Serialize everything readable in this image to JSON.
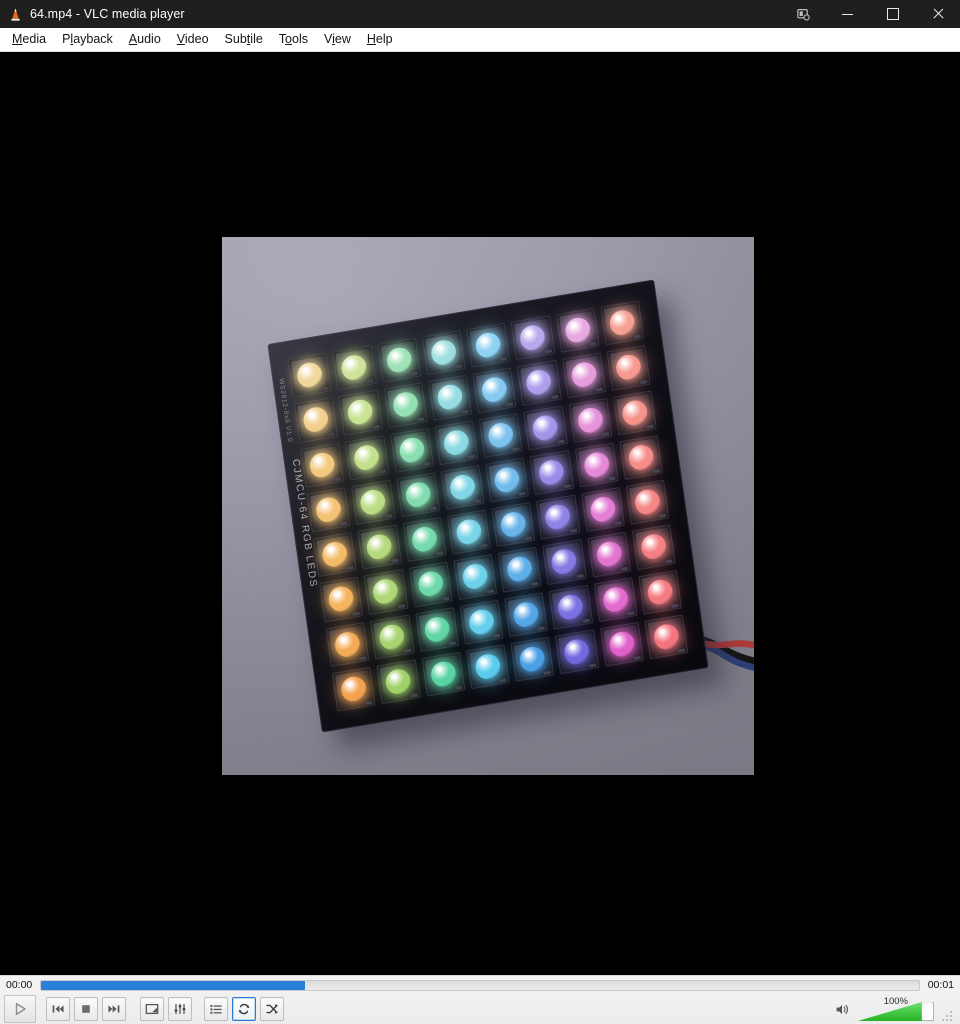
{
  "window": {
    "title": "64.mp4 - VLC media player",
    "app_icon": "vlc-cone-icon",
    "buttons": {
      "snap_label": "snap-layout-icon",
      "minimize_label": "minimize-icon",
      "maximize_label": "restore-icon",
      "close_label": "close-icon"
    }
  },
  "menubar": {
    "items": [
      {
        "label": "Media",
        "accel": "M",
        "before": "",
        "after": "edia"
      },
      {
        "label": "Playback",
        "accel": "l",
        "before": "P",
        "after": "ayback"
      },
      {
        "label": "Audio",
        "accel": "A",
        "before": "",
        "after": "udio"
      },
      {
        "label": "Video",
        "accel": "V",
        "before": "",
        "after": "ideo"
      },
      {
        "label": "Subtitle",
        "accel": "t",
        "before": "Sub",
        "after": "le"
      },
      {
        "label": "Tools",
        "accel": "o",
        "before": "T",
        "after": "ols"
      },
      {
        "label": "View",
        "accel": "i",
        "before": "V",
        "after": "ew"
      },
      {
        "label": "Help",
        "accel": "H",
        "before": "",
        "after": "elp"
      }
    ]
  },
  "video": {
    "description": "CJMCU-64 8x8 RGB LED matrix board lit in a rainbow gradient, lying on a light gray-lavender surface with a twisted red/blue/black wire harness exiting the lower-right corner",
    "board_silkscreen": "CJMCU-64 RGB LEDS",
    "board_silkscreen_small": "WS2812-8x8 V1.0",
    "background_color": "#9a9aab",
    "letterbox_color": "#000000",
    "led_rows": [
      [
        "#f0d79a",
        "#cfe39a",
        "#9fe2b6",
        "#9fe0df",
        "#8fd2f2",
        "#b9a8ee",
        "#e8a8e0",
        "#f6a192"
      ],
      [
        "#f2cf8c",
        "#c9e294",
        "#93e0b4",
        "#96dde2",
        "#86caf0",
        "#ae9eec",
        "#e79ddd",
        "#f69a8f"
      ],
      [
        "#f3c97f",
        "#c3e08d",
        "#8adeb1",
        "#8cdae4",
        "#7cc3ef",
        "#a495ea",
        "#e693da",
        "#f6948c"
      ],
      [
        "#f4c274",
        "#bcdd85",
        "#81dcaf",
        "#82d7e6",
        "#72bced",
        "#9a8ce8",
        "#e589d7",
        "#f58d89"
      ],
      [
        "#f4bb69",
        "#b5da7e",
        "#77daac",
        "#78d4e8",
        "#68b5eb",
        "#9083e6",
        "#e47fd4",
        "#f58686"
      ],
      [
        "#f5b45f",
        "#aed776",
        "#6dd8a9",
        "#6ed1ea",
        "#5eaee9",
        "#867ae4",
        "#e375d1",
        "#f48084"
      ],
      [
        "#f3ab57",
        "#a7d46f",
        "#63d6a6",
        "#64ceec",
        "#54a7e7",
        "#7c71e2",
        "#e26bce",
        "#f47a81"
      ],
      [
        "#f2a250",
        "#a0d168",
        "#59d4a3",
        "#5acbee",
        "#4aa0e5",
        "#7268e0",
        "#e161cb",
        "#f3747f"
      ]
    ],
    "cable_colors": [
      "#b03a3a",
      "#2d3f7a",
      "#151515"
    ]
  },
  "controls": {
    "elapsed_time": "00:00",
    "total_time": "00:01",
    "progress_percent": 30,
    "progress_fill_color": "#2a80d8",
    "buttons": [
      {
        "name": "play-button",
        "label": "Play"
      },
      {
        "name": "previous-button",
        "label": "Previous media"
      },
      {
        "name": "stop-button",
        "label": "Stop playback"
      },
      {
        "name": "next-button",
        "label": "Next media"
      },
      {
        "name": "fullscreen-button",
        "label": "Toggle fullscreen"
      },
      {
        "name": "extended-settings-button",
        "label": "Show extended settings"
      },
      {
        "name": "playlist-button",
        "label": "Show playlist"
      },
      {
        "name": "loop-button",
        "label": "Click to toggle between loop all, loop one and no loop"
      },
      {
        "name": "random-button",
        "label": "Random"
      }
    ],
    "loop_active": true,
    "volume": {
      "label": "100%",
      "value": 100,
      "fill_color": "#35c435",
      "icon": "speaker-icon"
    }
  }
}
